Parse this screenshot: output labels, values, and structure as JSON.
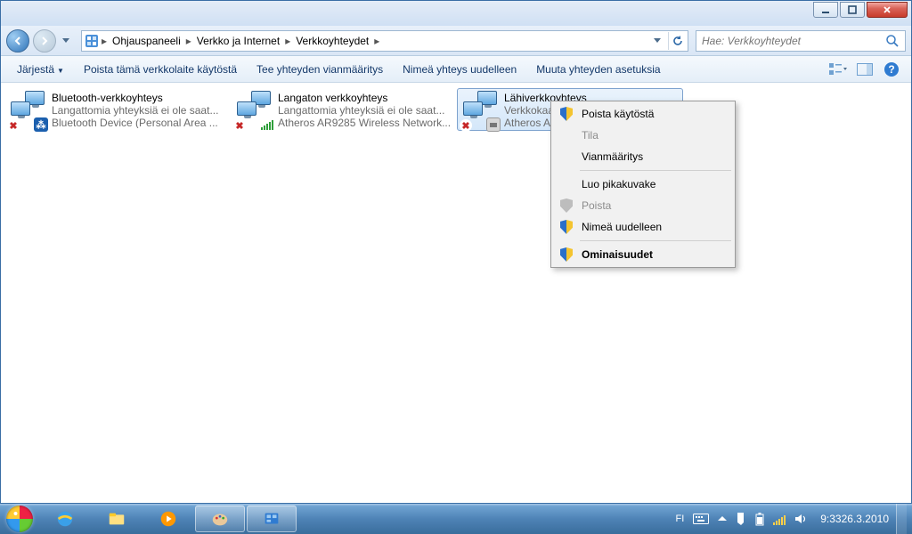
{
  "breadcrumb": {
    "p1": "Ohjauspaneeli",
    "p2": "Verkko ja Internet",
    "p3": "Verkkoyhteydet"
  },
  "search": {
    "placeholder": "Hae: Verkkoyhteydet"
  },
  "toolbar": {
    "organize": "Järjestä",
    "disable": "Poista tämä verkkolaite käytöstä",
    "diagnose": "Tee yhteyden vianmääritys",
    "rename": "Nimeä yhteys uudelleen",
    "settings": "Muuta yhteyden asetuksia"
  },
  "connections": [
    {
      "name": "Bluetooth-verkkoyhteys",
      "status": "Langattomia yhteyksiä ei ole saat...",
      "device": "Bluetooth Device (Personal Area ...",
      "sub": "bt"
    },
    {
      "name": "Langaton verkkoyhteys",
      "status": "Langattomia yhteyksiä ei ole saat...",
      "device": "Atheros AR9285 Wireless Network...",
      "sub": "wifi"
    },
    {
      "name": "Lähiverkkoyhteys",
      "status": "Verkkokaap",
      "device": "Atheros AR",
      "sub": "eth",
      "selected": true
    }
  ],
  "context_menu": {
    "disable": "Poista käytöstä",
    "status": "Tila",
    "diagnose": "Vianmääritys",
    "shortcut": "Luo pikakuvake",
    "delete": "Poista",
    "rename": "Nimeä uudelleen",
    "properties": "Ominaisuudet"
  },
  "tray": {
    "lang": "FI",
    "time": "9:33",
    "date": "26.3.2010"
  }
}
